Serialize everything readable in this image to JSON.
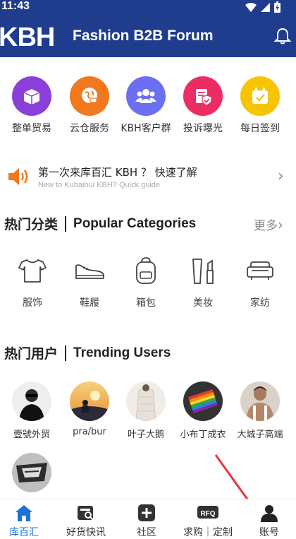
{
  "status_bar": {
    "time": "11:43"
  },
  "header": {
    "logo": "KBH",
    "title": "Fashion B2B Forum"
  },
  "quick_actions": [
    {
      "label": "整单贸易",
      "color": "#8b3fd9",
      "icon": "box-icon"
    },
    {
      "label": "云仓服务",
      "color": "#f2781f",
      "icon": "globe-cart-icon"
    },
    {
      "label": "KBH客户群",
      "color": "#6b6ff0",
      "icon": "group-icon"
    },
    {
      "label": "投诉曝光",
      "color": "#ec2d64",
      "icon": "shield-icon"
    },
    {
      "label": "每日签到",
      "color": "#f6c400",
      "icon": "calendar-check-icon"
    }
  ],
  "guide": {
    "title": "第一次来库百汇 KBH ？ 快速了解",
    "subtitle": "New to Kubaihui KBH? Quick guide"
  },
  "categories_section": {
    "title_cn": "热门分类",
    "title_en": "Popular Categories",
    "more": "更多"
  },
  "categories": [
    {
      "label": "服饰",
      "icon": "tshirt-icon"
    },
    {
      "label": "鞋履",
      "icon": "sneaker-icon"
    },
    {
      "label": "箱包",
      "icon": "backpack-icon"
    },
    {
      "label": "美妆",
      "icon": "cosmetics-icon"
    },
    {
      "label": "家纺",
      "icon": "sofa-icon"
    }
  ],
  "users_section": {
    "title_cn": "热门用户",
    "title_en": "Trending Users"
  },
  "users": [
    {
      "name": "壹號外贸"
    },
    {
      "name": "pra/bur"
    },
    {
      "name": "叶子大鹅"
    },
    {
      "name": "小布丁成衣"
    },
    {
      "name": "大城子高端"
    },
    {
      "name": ""
    }
  ],
  "tabs": [
    {
      "label": "库百汇",
      "active": true,
      "icon": "home-icon"
    },
    {
      "label": "好货快讯",
      "active": false,
      "icon": "news-search-icon"
    },
    {
      "label": "社区",
      "active": false,
      "icon": "plus-box-icon"
    },
    {
      "label": "求购｜定制",
      "active": false,
      "icon": "rfq-icon"
    },
    {
      "label": "账号",
      "active": false,
      "icon": "person-icon"
    }
  ]
}
